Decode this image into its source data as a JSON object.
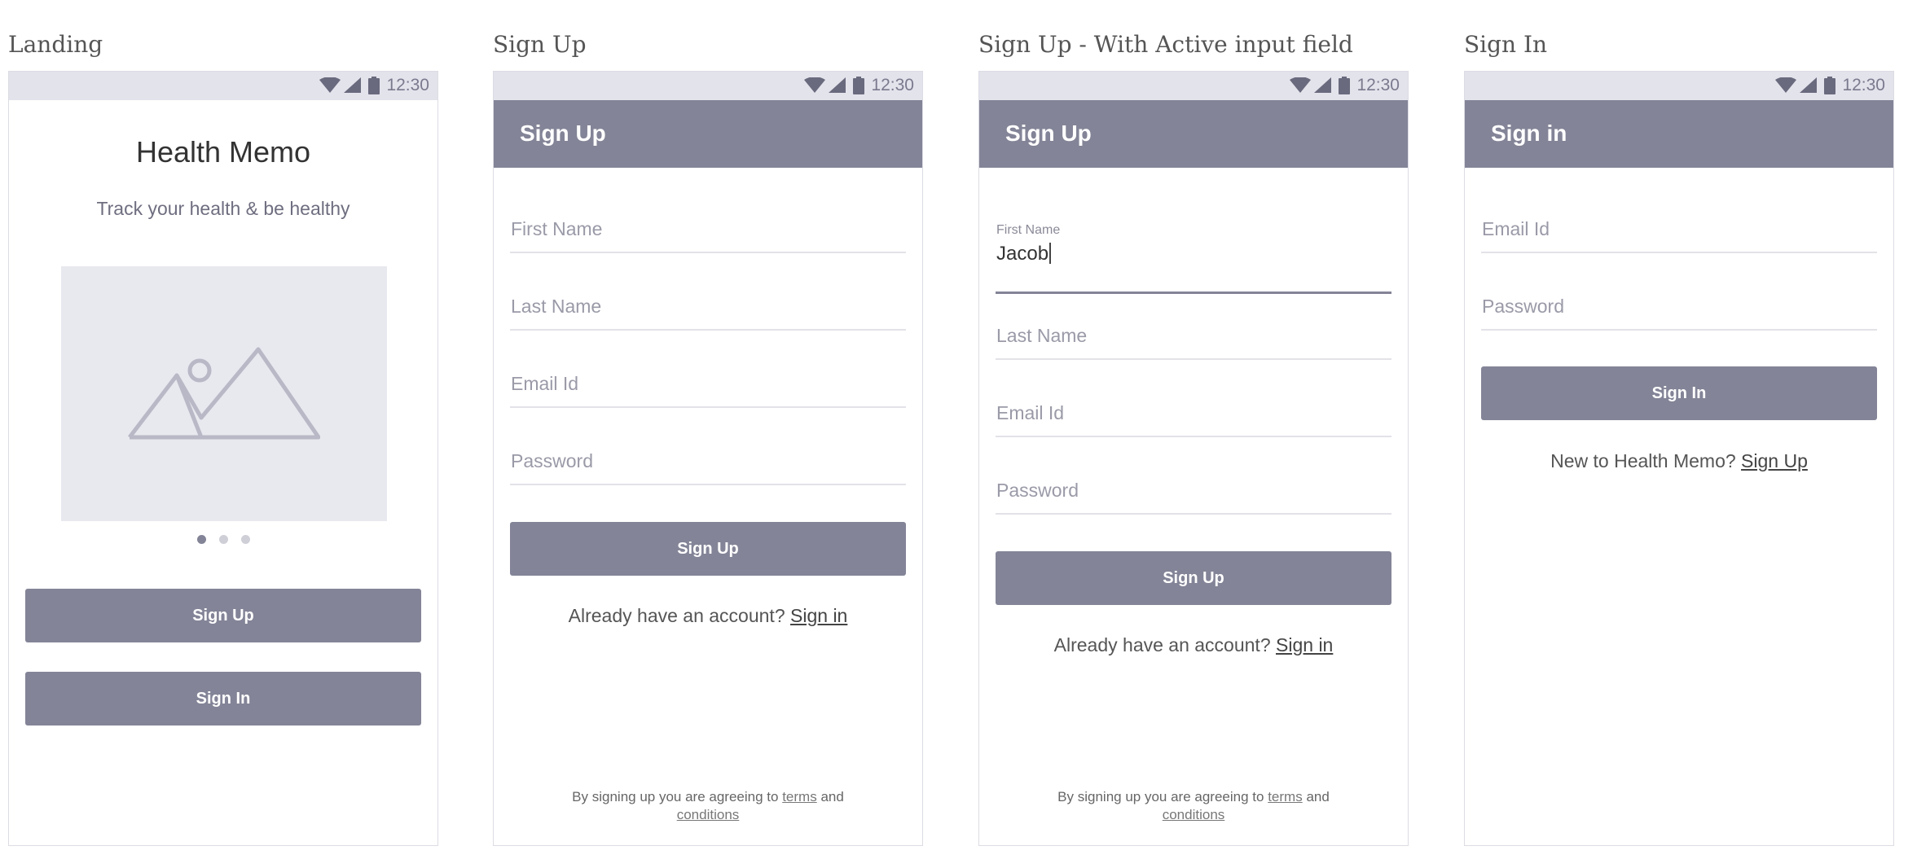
{
  "status_bar": {
    "time": "12:30"
  },
  "screens": {
    "landing": {
      "caption": "Landing",
      "title": "Health Memo",
      "subtitle": "Track your health & be healthy",
      "carousel_pages": 3,
      "carousel_active": 1,
      "signup_button": "Sign Up",
      "signin_button": "Sign In"
    },
    "signup": {
      "caption": "Sign Up",
      "appbar_title": "Sign Up",
      "fields": {
        "first_name": "First Name",
        "last_name": "Last Name",
        "email": "Email Id",
        "password": "Password"
      },
      "submit_button": "Sign Up",
      "account_prompt": "Already have an account?",
      "signin_link": "Sign in",
      "terms_prefix": "By signing up you are agreeing to",
      "terms_link": "terms",
      "terms_and": "and",
      "conditions_link": "conditions"
    },
    "signup_active": {
      "caption": "Sign Up - With Active input field",
      "appbar_title": "Sign Up",
      "first_name_label": "First Name",
      "first_name_value": "Jacob",
      "fields": {
        "last_name": "Last Name",
        "email": "Email Id",
        "password": "Password"
      },
      "submit_button": "Sign Up",
      "account_prompt": "Already have an account?",
      "signin_link": "Sign in",
      "terms_prefix": "By signing up you are agreeing to",
      "terms_link": "terms",
      "terms_and": "and",
      "conditions_link": "conditions"
    },
    "signin": {
      "caption": "Sign In",
      "appbar_title": "Sign in",
      "fields": {
        "email": "Email Id",
        "password": "Password"
      },
      "submit_button": "Sign In",
      "new_user_prompt": "New to Health Memo?",
      "signup_link": "Sign Up"
    }
  },
  "colors": {
    "accent": "#838497",
    "status_bar": "#e3e3ec",
    "image_placeholder": "#e8e8ef",
    "divider": "#e2e2e8"
  },
  "icons": {
    "status": [
      "wifi-icon",
      "cellular-signal-icon",
      "battery-icon"
    ],
    "hero": "image-placeholder-icon"
  }
}
